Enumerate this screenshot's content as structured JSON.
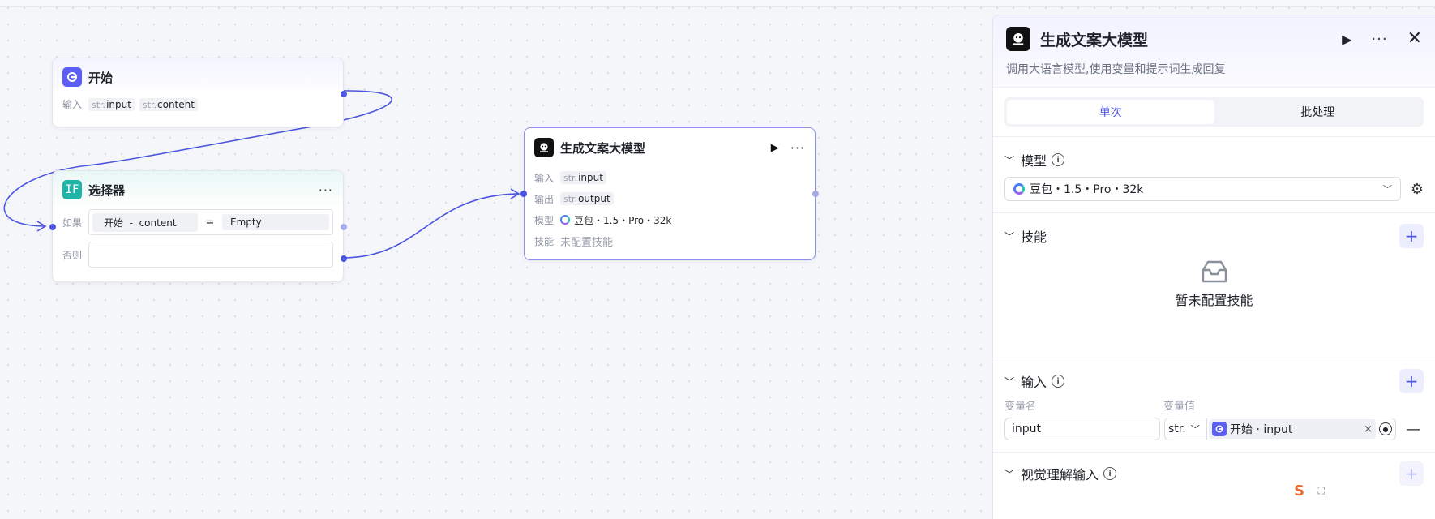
{
  "canvas": {
    "start_node": {
      "title": "开始",
      "input_label": "输入",
      "outputs": [
        {
          "type": "str.",
          "name": "input"
        },
        {
          "type": "str.",
          "name": "content"
        }
      ]
    },
    "selector_node": {
      "title": "选择器",
      "icon_text": "IF",
      "if_label": "如果",
      "else_label": "否则",
      "condition": {
        "left": "开始  -  content",
        "operator": "=",
        "right": "Empty"
      }
    },
    "llm_node": {
      "title": "生成文案大模型",
      "input_label": "输入",
      "output_label": "输出",
      "model_label": "模型",
      "skill_label": "技能",
      "input_tag": {
        "type": "str.",
        "name": "input"
      },
      "output_tag": {
        "type": "str.",
        "name": "output"
      },
      "model_value": "豆包・1.5・Pro・32k",
      "skill_value": "未配置技能"
    }
  },
  "panel": {
    "title": "生成文案大模型",
    "description": "调用大语言模型,使用变量和提示词生成回复",
    "tabs": [
      "单次",
      "批处理"
    ],
    "active_tab": 0,
    "model_section": {
      "title": "模型",
      "selected": "豆包・1.5・Pro・32k"
    },
    "skill_section": {
      "title": "技能",
      "empty_text": "暂未配置技能"
    },
    "input_section": {
      "title": "输入",
      "col_name": "变量名",
      "col_value": "变量值",
      "row": {
        "name": "input",
        "type": "str.",
        "ref": "开始 · input"
      }
    },
    "vision_section": {
      "title": "视觉理解输入"
    }
  },
  "colors": {
    "accent": "#4c55e0",
    "start_icon": "#5b5ff5",
    "selector_icon": "#1fb4a6",
    "llm_icon": "#111111"
  }
}
